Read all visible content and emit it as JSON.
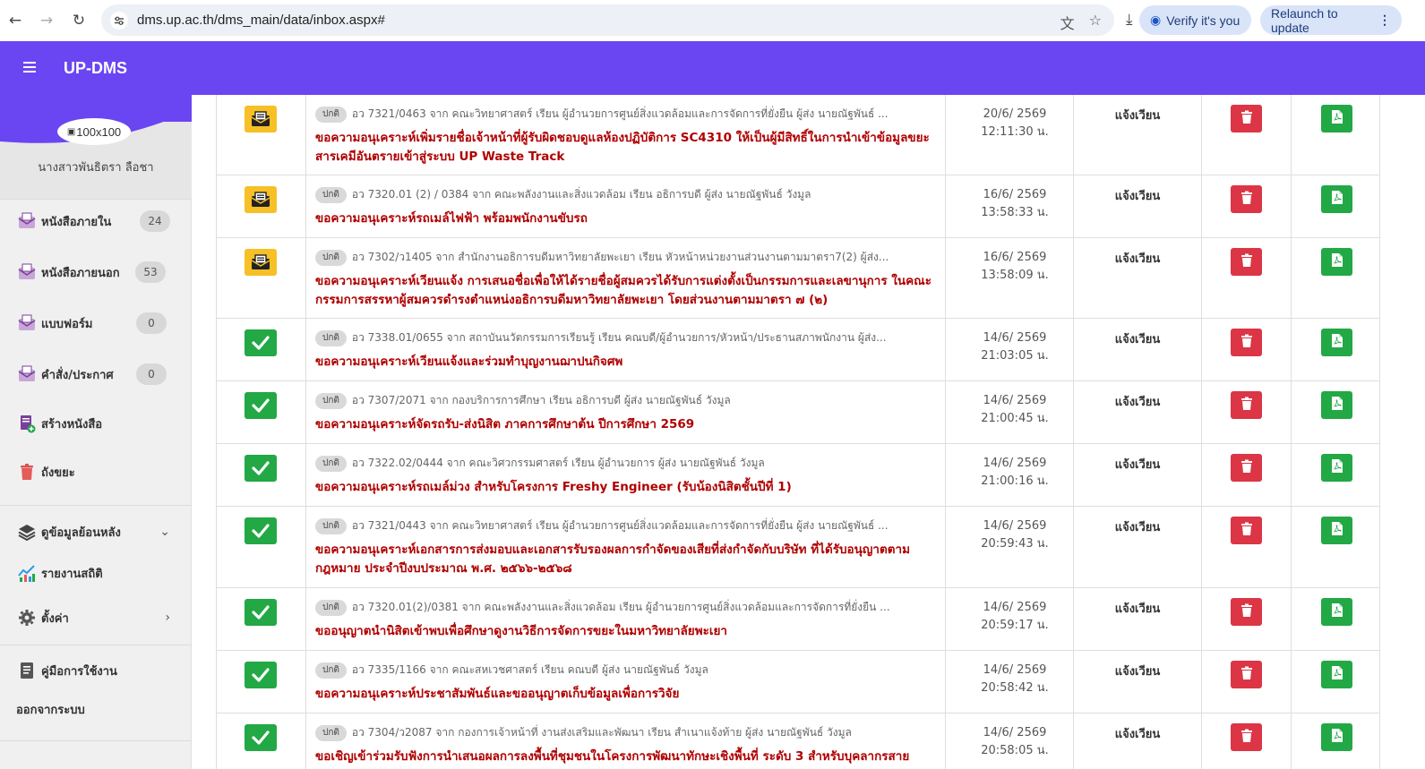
{
  "browser": {
    "url": "dms.up.ac.th/dms_main/data/inbox.aspx#",
    "verify_label": "Verify it's you",
    "relaunch_label": "Relaunch to update"
  },
  "app": {
    "title": "UP-DMS",
    "accent": "#6a45f2"
  },
  "profile": {
    "avatar_alt": "100x100",
    "name": "นางสาวพันธิตรา ลือชา"
  },
  "sidebar": {
    "items": [
      {
        "label": "หนังสือภายใน",
        "count": "24",
        "icon": "inbox-icon"
      },
      {
        "label": "หนังสือภายนอก",
        "count": "53",
        "icon": "inbox-icon"
      },
      {
        "label": "แบบฟอร์ม",
        "count": "0",
        "icon": "inbox-icon"
      },
      {
        "label": "คำสั่ง/ประกาศ",
        "count": "0",
        "icon": "inbox-icon"
      },
      {
        "label": "สร้างหนังสือ",
        "icon": "create-document-icon"
      },
      {
        "label": "ถังขยะ",
        "icon": "trash-icon"
      },
      {
        "label": "ดูข้อมูลย้อนหลัง",
        "icon": "layers-icon"
      },
      {
        "label": "รายงานสถิติ",
        "icon": "chart-icon"
      },
      {
        "label": "ตั้งค่า",
        "icon": "gear-icon"
      },
      {
        "label": "คู่มือการใช้งาน",
        "icon": "manual-icon"
      },
      {
        "label": "ออกจากระบบ"
      }
    ]
  },
  "rows": [
    {
      "status": "unread",
      "priority": "ปกติ",
      "meta": "อว 7321/0463 จาก คณะวิทยาศาสตร์ เรียน ผู้อำนวยการศูนย์สิ่งแวดล้อมและการจัดการที่ยั่งยืน ผู้ส่ง นายณัฐพันธ์ ...",
      "subject": "ขอความอนุเคราะห์เพิ่มรายชื่อเจ้าหน้าที่ผู้รับผิดชอบดูแลห้องปฏิบัติการ SC4310 ให้เป็นผู้มีสิทธิ์ในการนำเข้าข้อมูลขยะสารเคมีอันตรายเข้าสู่ระบบ UP Waste Track",
      "date": "20/6/ 2569",
      "time": "12:11:30 น.",
      "type": "แจ้งเวียน"
    },
    {
      "status": "unread",
      "priority": "ปกติ",
      "meta": "อว 7320.01 (2) / 0384 จาก คณะพลังงานและสิ่งแวดล้อม เรียน อธิการบดี ผู้ส่ง นายณัฐพันธ์ วังมูล",
      "subject": "ขอความอนุเคราะห์รถเมล์ไฟฟ้า พร้อมพนักงานขับรถ",
      "date": "16/6/ 2569",
      "time": "13:58:33 น.",
      "type": "แจ้งเวียน"
    },
    {
      "status": "unread",
      "priority": "ปกติ",
      "meta": "อว 7302/ว1405 จาก สำนักงานอธิการบดีมหาวิทยาลัยพะเยา เรียน หัวหน้าหน่วยงานส่วนงานตามมาตรา7(2) ผู้ส่ง...",
      "subject": "ขอความอนุเคราะห์เวียนแจ้ง การเสนอชื่อเพื่อให้ได้รายชื่อผู้สมควรได้รับการแต่งตั้งเป็นกรรมการและเลขานุการ ในคณะกรรมการสรรหาผู้สมควรดำรงตำแหน่งอธิการบดีมหาวิทยาลัยพะเยา โดยส่วนงานตามมาตรา ๗ (๒)",
      "date": "16/6/ 2569",
      "time": "13:58:09 น.",
      "type": "แจ้งเวียน"
    },
    {
      "status": "read",
      "priority": "ปกติ",
      "meta": "อว 7338.01/0655 จาก สถาบันนวัตกรรมการเรียนรู้ เรียน คณบดี/ผู้อำนวยการ/หัวหน้า/ประธานสภาพนักงาน ผู้ส่ง...",
      "subject": "ขอความอนุเคราะห์เวียนแจ้งและร่วมทำบุญงานฌาปนกิจศพ",
      "date": "14/6/ 2569",
      "time": "21:03:05 น.",
      "type": "แจ้งเวียน"
    },
    {
      "status": "read",
      "priority": "ปกติ",
      "meta": "อว 7307/2071 จาก กองบริการการศึกษา เรียน อธิการบดี ผู้ส่ง นายณัฐพันธ์ วังมูล",
      "subject": "ขอความอนุเคราะห์จัดรถรับ-ส่งนิสิต ภาคการศึกษาต้น ปีการศึกษา 2569",
      "date": "14/6/ 2569",
      "time": "21:00:45 น.",
      "type": "แจ้งเวียน"
    },
    {
      "status": "read",
      "priority": "ปกติ",
      "meta": "อว 7322.02/0444 จาก คณะวิศวกรรมศาสตร์ เรียน ผู้อำนวยการ ผู้ส่ง นายณัฐพันธ์ วังมูล",
      "subject": "ขอความอนุเคราะห์รถเมล์ม่วง สำหรับโครงการ Freshy Engineer (รับน้องนิสิตชั้นปีที่ 1)",
      "date": "14/6/ 2569",
      "time": "21:00:16 น.",
      "type": "แจ้งเวียน"
    },
    {
      "status": "read",
      "priority": "ปกติ",
      "meta": "อว 7321/0443 จาก คณะวิทยาศาสตร์ เรียน ผู้อำนวยการศูนย์สิ่งแวดล้อมและการจัดการที่ยั่งยืน ผู้ส่ง นายณัฐพันธ์ ...",
      "subject": "ขอความอนุเคราะห์เอกสารการส่งมอบและเอกสารรับรองผลการกำจัดของเสียที่ส่งกำจัดกับบริษัท ที่ได้รับอนุญาตตามกฎหมาย ประจำปีงบประมาณ พ.ศ. ๒๕๖๖-๒๕๖๘",
      "date": "14/6/ 2569",
      "time": "20:59:43 น.",
      "type": "แจ้งเวียน"
    },
    {
      "status": "read",
      "priority": "ปกติ",
      "meta": "อว 7320.01(2)/0381 จาก คณะพลังงานและสิ่งแวดล้อม เรียน ผู้อำนวยการศูนย์สิ่งแวดล้อมและการจัดการที่ยั่งยืน ...",
      "subject": "ขออนุญาตนำนิสิตเข้าพบเพื่อศึกษาดูงานวิธีการจัดการขยะในมหาวิทยาลัยพะเยา",
      "date": "14/6/ 2569",
      "time": "20:59:17 น.",
      "type": "แจ้งเวียน"
    },
    {
      "status": "read",
      "priority": "ปกติ",
      "meta": "อว 7335/1166 จาก คณะสหเวชศาสตร์ เรียน คณบดี ผู้ส่ง นายณัฐพันธ์ วังมูล",
      "subject": "ขอความอนุเคราะห์ประชาสัมพันธ์และขออนุญาตเก็บข้อมูลเพื่อการวิจัย",
      "date": "14/6/ 2569",
      "time": "20:58:42 น.",
      "type": "แจ้งเวียน"
    },
    {
      "status": "read",
      "priority": "ปกติ",
      "meta": "อว 7304/ว2087 จาก กองการเจ้าหน้าที่ งานส่งเสริมและพัฒนา เรียน สำเนาแจ้งท้าย ผู้ส่ง นายณัฐพันธ์ วังมูล",
      "subject": "ขอเชิญเข้าร่วมรับฟังการนำเสนอผลการลงพื้นที่ชุมชนในโครงการพัฒนาทักษะเชิงพื้นที่ ระดับ 3 สำหรับบุคลากรสายสนับสนุน",
      "date": "14/6/ 2569",
      "time": "20:58:05 น.",
      "type": "แจ้งเวียน"
    }
  ]
}
